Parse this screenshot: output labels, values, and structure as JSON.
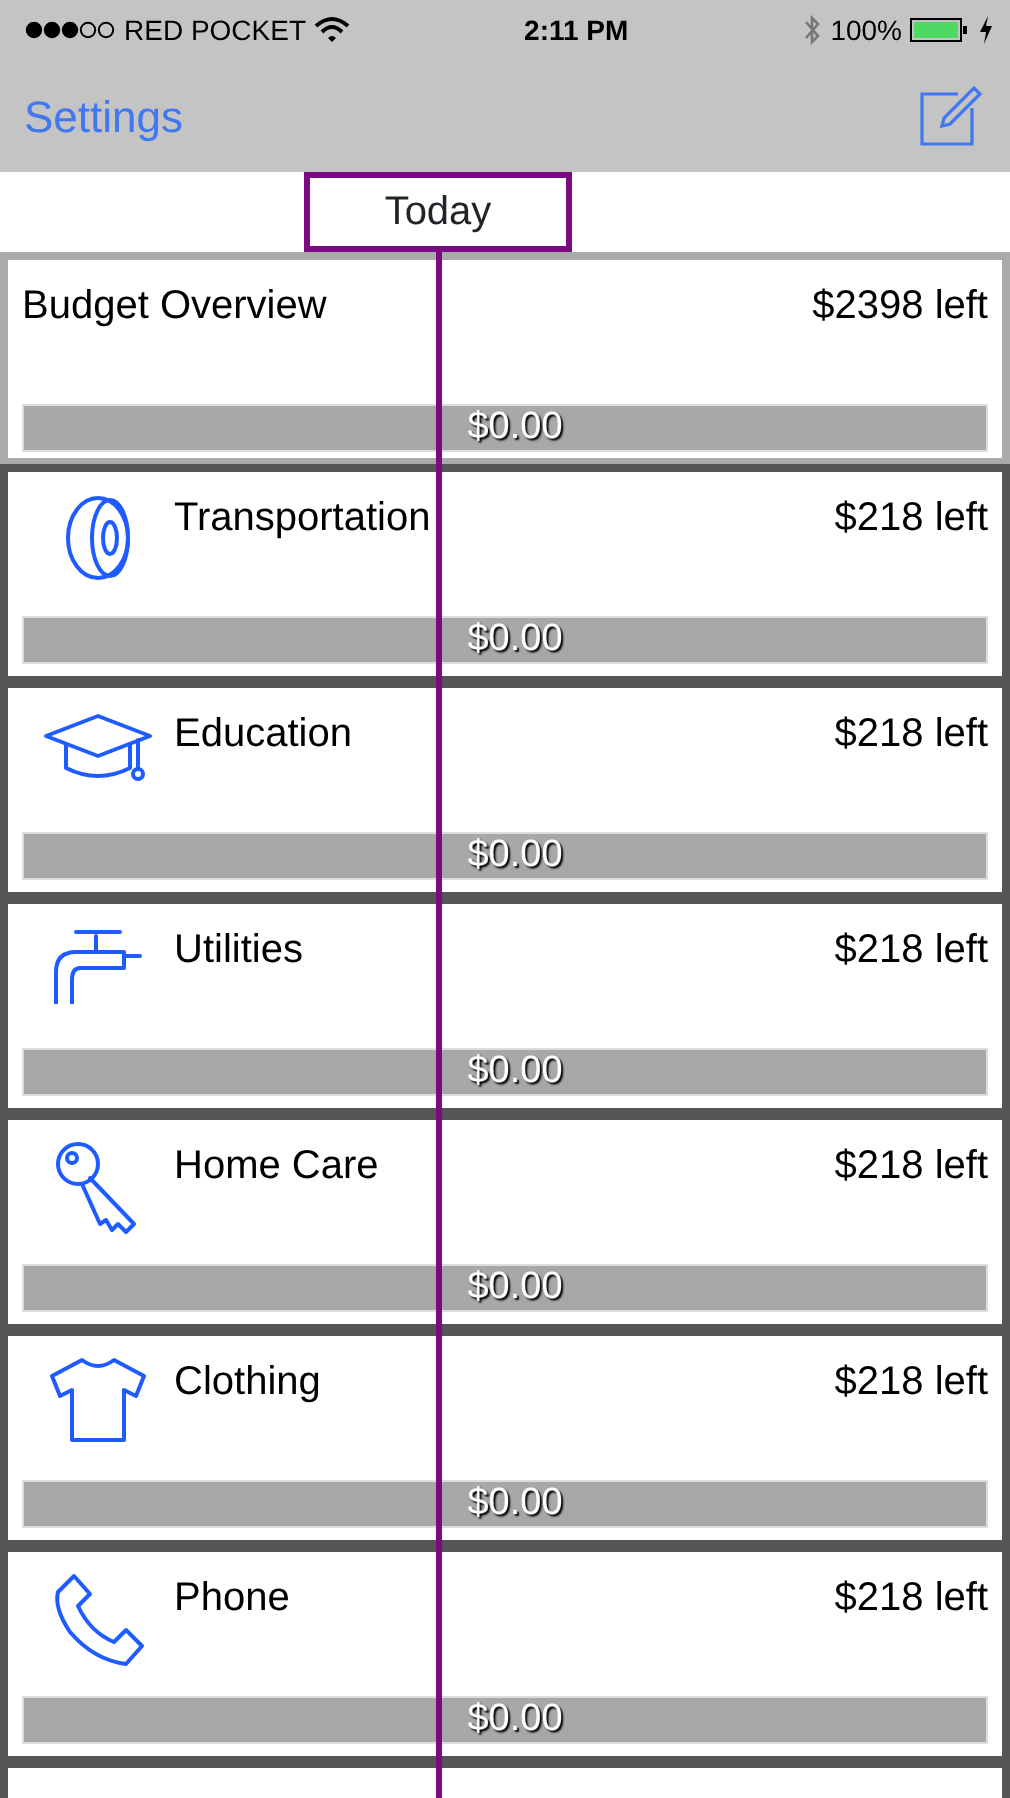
{
  "status_bar": {
    "carrier": "RED POCKET",
    "time": "2:11 PM",
    "battery_percent": "100%"
  },
  "nav_bar": {
    "left_button": "Settings"
  },
  "timeline": {
    "marker_label": "Today"
  },
  "overview": {
    "title": "Budget Overview",
    "remaining": "$2398 left",
    "spent": "$0.00"
  },
  "categories": [
    {
      "kind": "tire",
      "name": "Transportation",
      "remaining": "$218 left",
      "spent": "$0.00"
    },
    {
      "kind": "cap",
      "name": "Education",
      "remaining": "$218 left",
      "spent": "$0.00"
    },
    {
      "kind": "faucet",
      "name": "Utilities",
      "remaining": "$218 left",
      "spent": "$0.00"
    },
    {
      "kind": "key",
      "name": "Home Care",
      "remaining": "$218 left",
      "spent": "$0.00"
    },
    {
      "kind": "shirt",
      "name": "Clothing",
      "remaining": "$218 left",
      "spent": "$0.00"
    },
    {
      "kind": "phone",
      "name": "Phone",
      "remaining": "$218 left",
      "spent": "$0.00"
    }
  ]
}
